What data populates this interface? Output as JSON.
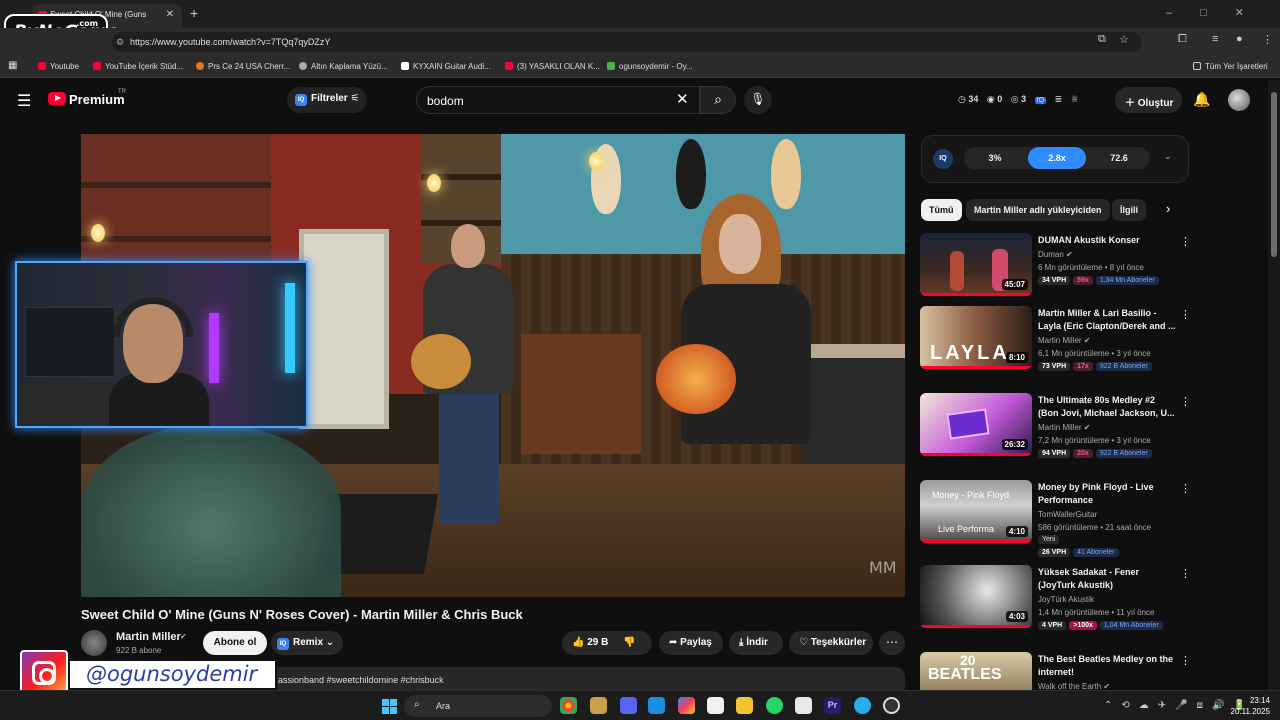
{
  "browser": {
    "tab_title": "Sweet Child O' Mine (Guns",
    "url": "https://www.youtube.com/watch?v=7TQq7qyDZzY",
    "bookmarks": [
      "Youtube",
      "YouTube İçerik Stüd...",
      "Prs Ce 24 USA Cherr...",
      "Altın Kaplama Yüzü...",
      "KYXAIN Guitar Audi...",
      "(3) YASAKLI OLAN K...",
      "ogunsoydemir - Oy..."
    ],
    "all_bookmarks": "Tüm Yer İşaretleri"
  },
  "overlay": {
    "logo": "ByNoGame",
    "logo_suffix": ".com",
    "instagram_handle": "@ogunsoydemir"
  },
  "header": {
    "brand": "Premium",
    "brand_sup": "TR",
    "filters": "Filtreler",
    "search_value": "bodom",
    "stats": [
      "34",
      "0",
      "3"
    ],
    "create": "Oluştur"
  },
  "video": {
    "title": "Sweet Child O' Mine (Guns N' Roses Cover) - Martin Miller & Chris Buck",
    "channel": "Martin Miller",
    "subscribers": "922 B abone",
    "subscribe": "Abone ol",
    "remix": "Remix",
    "likes": "29 B",
    "share": "Paylaş",
    "download": "İndir",
    "thanks": "Teşekkürler",
    "description_tags": "assionband #sweetchildomine #chrisbuck",
    "watermark": "MM"
  },
  "iq": {
    "logo": "IQ",
    "values": [
      "3%",
      "2.8x",
      "72.6"
    ]
  },
  "chips": {
    "all": "Tümü",
    "from_uploader": "Martin Miller adlı yükleyiciden",
    "related": "İlgili"
  },
  "recommendations": [
    {
      "title": "DUMAN Akustik Konser",
      "channel": "Duman",
      "meta": "6 Mn görüntüleme • 8 yıl önce",
      "duration": "45:07",
      "vph": "34 VPH",
      "x": "59x",
      "subs": "1,34 Mn Aboneler",
      "hot": false,
      "new": ""
    },
    {
      "title": "Martin Miller & Lari Basilio - Layla (Eric Clapton/Derek and ...",
      "channel": "Martin Miller",
      "meta": "6,1 Mn görüntüleme • 3 yıl önce",
      "duration": "8:10",
      "vph": "73 VPH",
      "x": "17x",
      "subs": "922 B Aboneler",
      "hot": false,
      "new": ""
    },
    {
      "title": "The Ultimate 80s Medley #2 (Bon Jovi, Michael Jackson, U...",
      "channel": "Martin Miller",
      "meta": "7,2 Mn görüntüleme • 3 yıl önce",
      "duration": "26:32",
      "vph": "94 VPH",
      "x": "20x",
      "subs": "922 B Aboneler",
      "hot": false,
      "new": ""
    },
    {
      "title": "Money by Pink Floyd - Live Performance",
      "channel": "TomWallerGuitar",
      "meta": "586 görüntüleme • 21 saat önce",
      "duration": "4:10",
      "vph": "26 VPH",
      "x": "",
      "subs": "41 Aboneler",
      "hot": false,
      "new": "Yeni"
    },
    {
      "title": "Yüksek Sadakat - Fener (JoyTurk Akustik)",
      "channel": "JoyTürk Akustik",
      "meta": "1,4 Mn görüntüleme • 11 yıl önce",
      "duration": "4:03",
      "vph": "4 VPH",
      "x": ">100x",
      "subs": "1,04 Mn Aboneler",
      "hot": true,
      "new": ""
    },
    {
      "title": "The Best Beatles Medley on the internet!",
      "channel": "Walk off the Earth",
      "meta": "",
      "duration": "",
      "vph": "",
      "x": "",
      "subs": "",
      "hot": false,
      "new": ""
    }
  ],
  "thumb_text": {
    "layla": "LAYLA",
    "money": "Money - Pink Floyd",
    "live": "Live Performa",
    "beatles_num": "20",
    "beatles": "BEATLES"
  },
  "taskbar": {
    "search": "Ara",
    "time": "23:14",
    "date": "20.11.2025"
  }
}
